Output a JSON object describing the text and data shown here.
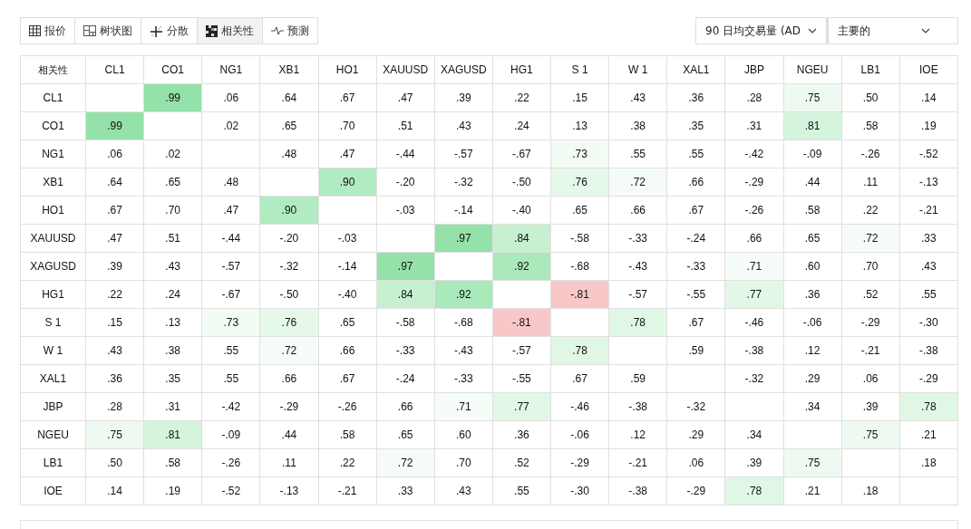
{
  "toolbar": {
    "tabs": [
      {
        "label": "报价",
        "selected": false
      },
      {
        "label": "树状图",
        "selected": false
      },
      {
        "label": "分散",
        "selected": false
      },
      {
        "label": "相关性",
        "selected": true
      },
      {
        "label": "预测",
        "selected": false
      }
    ],
    "dropdowns": [
      {
        "value": "90 日均交易量 (AD"
      },
      {
        "value": "主要的"
      }
    ]
  },
  "table": {
    "corner": "相关性",
    "columns": [
      "CL1",
      "CO1",
      "NG1",
      "XB1",
      "HO1",
      "XAUUSD",
      "XAGUSD",
      "HG1",
      "S 1",
      "W 1",
      "XAL1",
      "JBP",
      "NGEU",
      "LB1",
      "IOE"
    ],
    "rows": [
      {
        "label": "CL1",
        "cells": [
          null,
          {
            "text": ".99",
            "color": "#94e2a9"
          },
          ".06",
          ".64",
          ".67",
          ".47",
          ".39",
          ".22",
          ".15",
          ".43",
          ".36",
          ".28",
          {
            "text": ".75",
            "color": "#eefaf1"
          },
          ".50",
          ".14"
        ]
      },
      {
        "label": "CO1",
        "cells": [
          {
            "text": ".99",
            "color": "#94e2a9"
          },
          null,
          ".02",
          ".65",
          ".70",
          ".51",
          ".43",
          ".24",
          ".13",
          ".38",
          ".35",
          ".31",
          {
            "text": ".81",
            "color": "#d5f4dd"
          },
          ".58",
          ".19"
        ]
      },
      {
        "label": "NG1",
        "cells": [
          ".06",
          ".02",
          null,
          ".48",
          ".47",
          "-.44",
          "-.57",
          "-.67",
          {
            "text": ".73",
            "color": "#f2fbf4"
          },
          ".55",
          ".55",
          "-.42",
          "-.09",
          "-.26",
          "-.52"
        ]
      },
      {
        "label": "XB1",
        "cells": [
          ".64",
          ".65",
          ".48",
          null,
          {
            "text": ".90",
            "color": "#b1ebc1"
          },
          "-.20",
          "-.32",
          "-.50",
          {
            "text": ".76",
            "color": "#e6f8ea"
          },
          {
            "text": ".72",
            "color": "#f5fcf7"
          },
          ".66",
          "-.29",
          ".44",
          ".11",
          "-.13"
        ]
      },
      {
        "label": "HO1",
        "cells": [
          ".67",
          ".70",
          ".47",
          {
            "text": ".90",
            "color": "#b1ebc1"
          },
          null,
          "-.03",
          "-.14",
          "-.40",
          ".65",
          ".66",
          ".67",
          "-.26",
          ".58",
          ".22",
          "-.21"
        ]
      },
      {
        "label": "XAUUSD",
        "cells": [
          ".47",
          ".51",
          "-.44",
          "-.20",
          "-.03",
          null,
          {
            "text": ".97",
            "color": "#94e2a9"
          },
          {
            "text": ".84",
            "color": "#c7f0d1"
          },
          "-.58",
          "-.33",
          "-.24",
          ".66",
          ".65",
          {
            "text": ".72",
            "color": "#f5fcf7"
          },
          ".33"
        ]
      },
      {
        "label": "XAGUSD",
        "cells": [
          ".39",
          ".43",
          "-.57",
          "-.32",
          "-.14",
          {
            "text": ".97",
            "color": "#94e2a9"
          },
          null,
          {
            "text": ".92",
            "color": "#a9e9ba"
          },
          "-.68",
          "-.43",
          "-.33",
          {
            "text": ".71",
            "color": "#f6fcf7"
          },
          ".60",
          ".70",
          ".43"
        ]
      },
      {
        "label": "HG1",
        "cells": [
          ".22",
          ".24",
          "-.67",
          "-.50",
          "-.40",
          {
            "text": ".84",
            "color": "#c7f0d1"
          },
          {
            "text": ".92",
            "color": "#a9e9ba"
          },
          null,
          {
            "text": "-.81",
            "color": "#f8c8c9"
          },
          "-.57",
          "-.55",
          {
            "text": ".77",
            "color": "#e3f7e7"
          },
          ".36",
          ".52",
          ".55"
        ]
      },
      {
        "label": "S 1",
        "cells": [
          ".15",
          ".13",
          {
            "text": ".73",
            "color": "#f2fbf4"
          },
          {
            "text": ".76",
            "color": "#e6f8ea"
          },
          ".65",
          "-.58",
          "-.68",
          {
            "text": "-.81",
            "color": "#f8c8c9"
          },
          null,
          {
            "text": ".78",
            "color": "#e1f7e5"
          },
          ".67",
          "-.46",
          "-.06",
          "-.29",
          "-.30"
        ]
      },
      {
        "label": "W 1",
        "cells": [
          ".43",
          ".38",
          ".55",
          {
            "text": ".72",
            "color": "#f5fcf7"
          },
          ".66",
          "-.33",
          "-.43",
          "-.57",
          {
            "text": ".78",
            "color": "#e1f7e5"
          },
          null,
          ".59",
          "-.38",
          ".12",
          "-.21",
          "-.38"
        ]
      },
      {
        "label": "XAL1",
        "cells": [
          ".36",
          ".35",
          ".55",
          ".66",
          ".67",
          "-.24",
          "-.33",
          "-.55",
          ".67",
          ".59",
          null,
          "-.32",
          ".29",
          ".06",
          "-.29"
        ]
      },
      {
        "label": "JBP",
        "cells": [
          ".28",
          ".31",
          "-.42",
          "-.29",
          "-.26",
          ".66",
          {
            "text": ".71",
            "color": "#f6fcf7"
          },
          {
            "text": ".77",
            "color": "#e3f7e7"
          },
          "-.46",
          "-.38",
          "-.32",
          null,
          ".34",
          ".39",
          {
            "text": ".78",
            "color": "#e1f7e5"
          }
        ]
      },
      {
        "label": "NGEU",
        "cells": [
          {
            "text": ".75",
            "color": "#eefaf1"
          },
          {
            "text": ".81",
            "color": "#d5f4dd"
          },
          "-.09",
          ".44",
          ".58",
          ".65",
          ".60",
          ".36",
          "-.06",
          ".12",
          ".29",
          ".34",
          null,
          {
            "text": ".75",
            "color": "#eefaf1"
          },
          ".21"
        ]
      },
      {
        "label": "LB1",
        "cells": [
          ".50",
          ".58",
          "-.26",
          ".11",
          ".22",
          {
            "text": ".72",
            "color": "#f5fcf7"
          },
          ".70",
          ".52",
          "-.29",
          "-.21",
          ".06",
          ".39",
          {
            "text": ".75",
            "color": "#eefaf1"
          },
          null,
          ".18"
        ]
      },
      {
        "label": "IOE",
        "cells": [
          ".14",
          ".19",
          "-.52",
          "-.13",
          "-.21",
          ".33",
          ".43",
          ".55",
          "-.30",
          "-.38",
          "-.29",
          {
            "text": ".78",
            "color": "#e1f7e5"
          },
          ".21",
          ".18",
          null
        ]
      }
    ]
  }
}
